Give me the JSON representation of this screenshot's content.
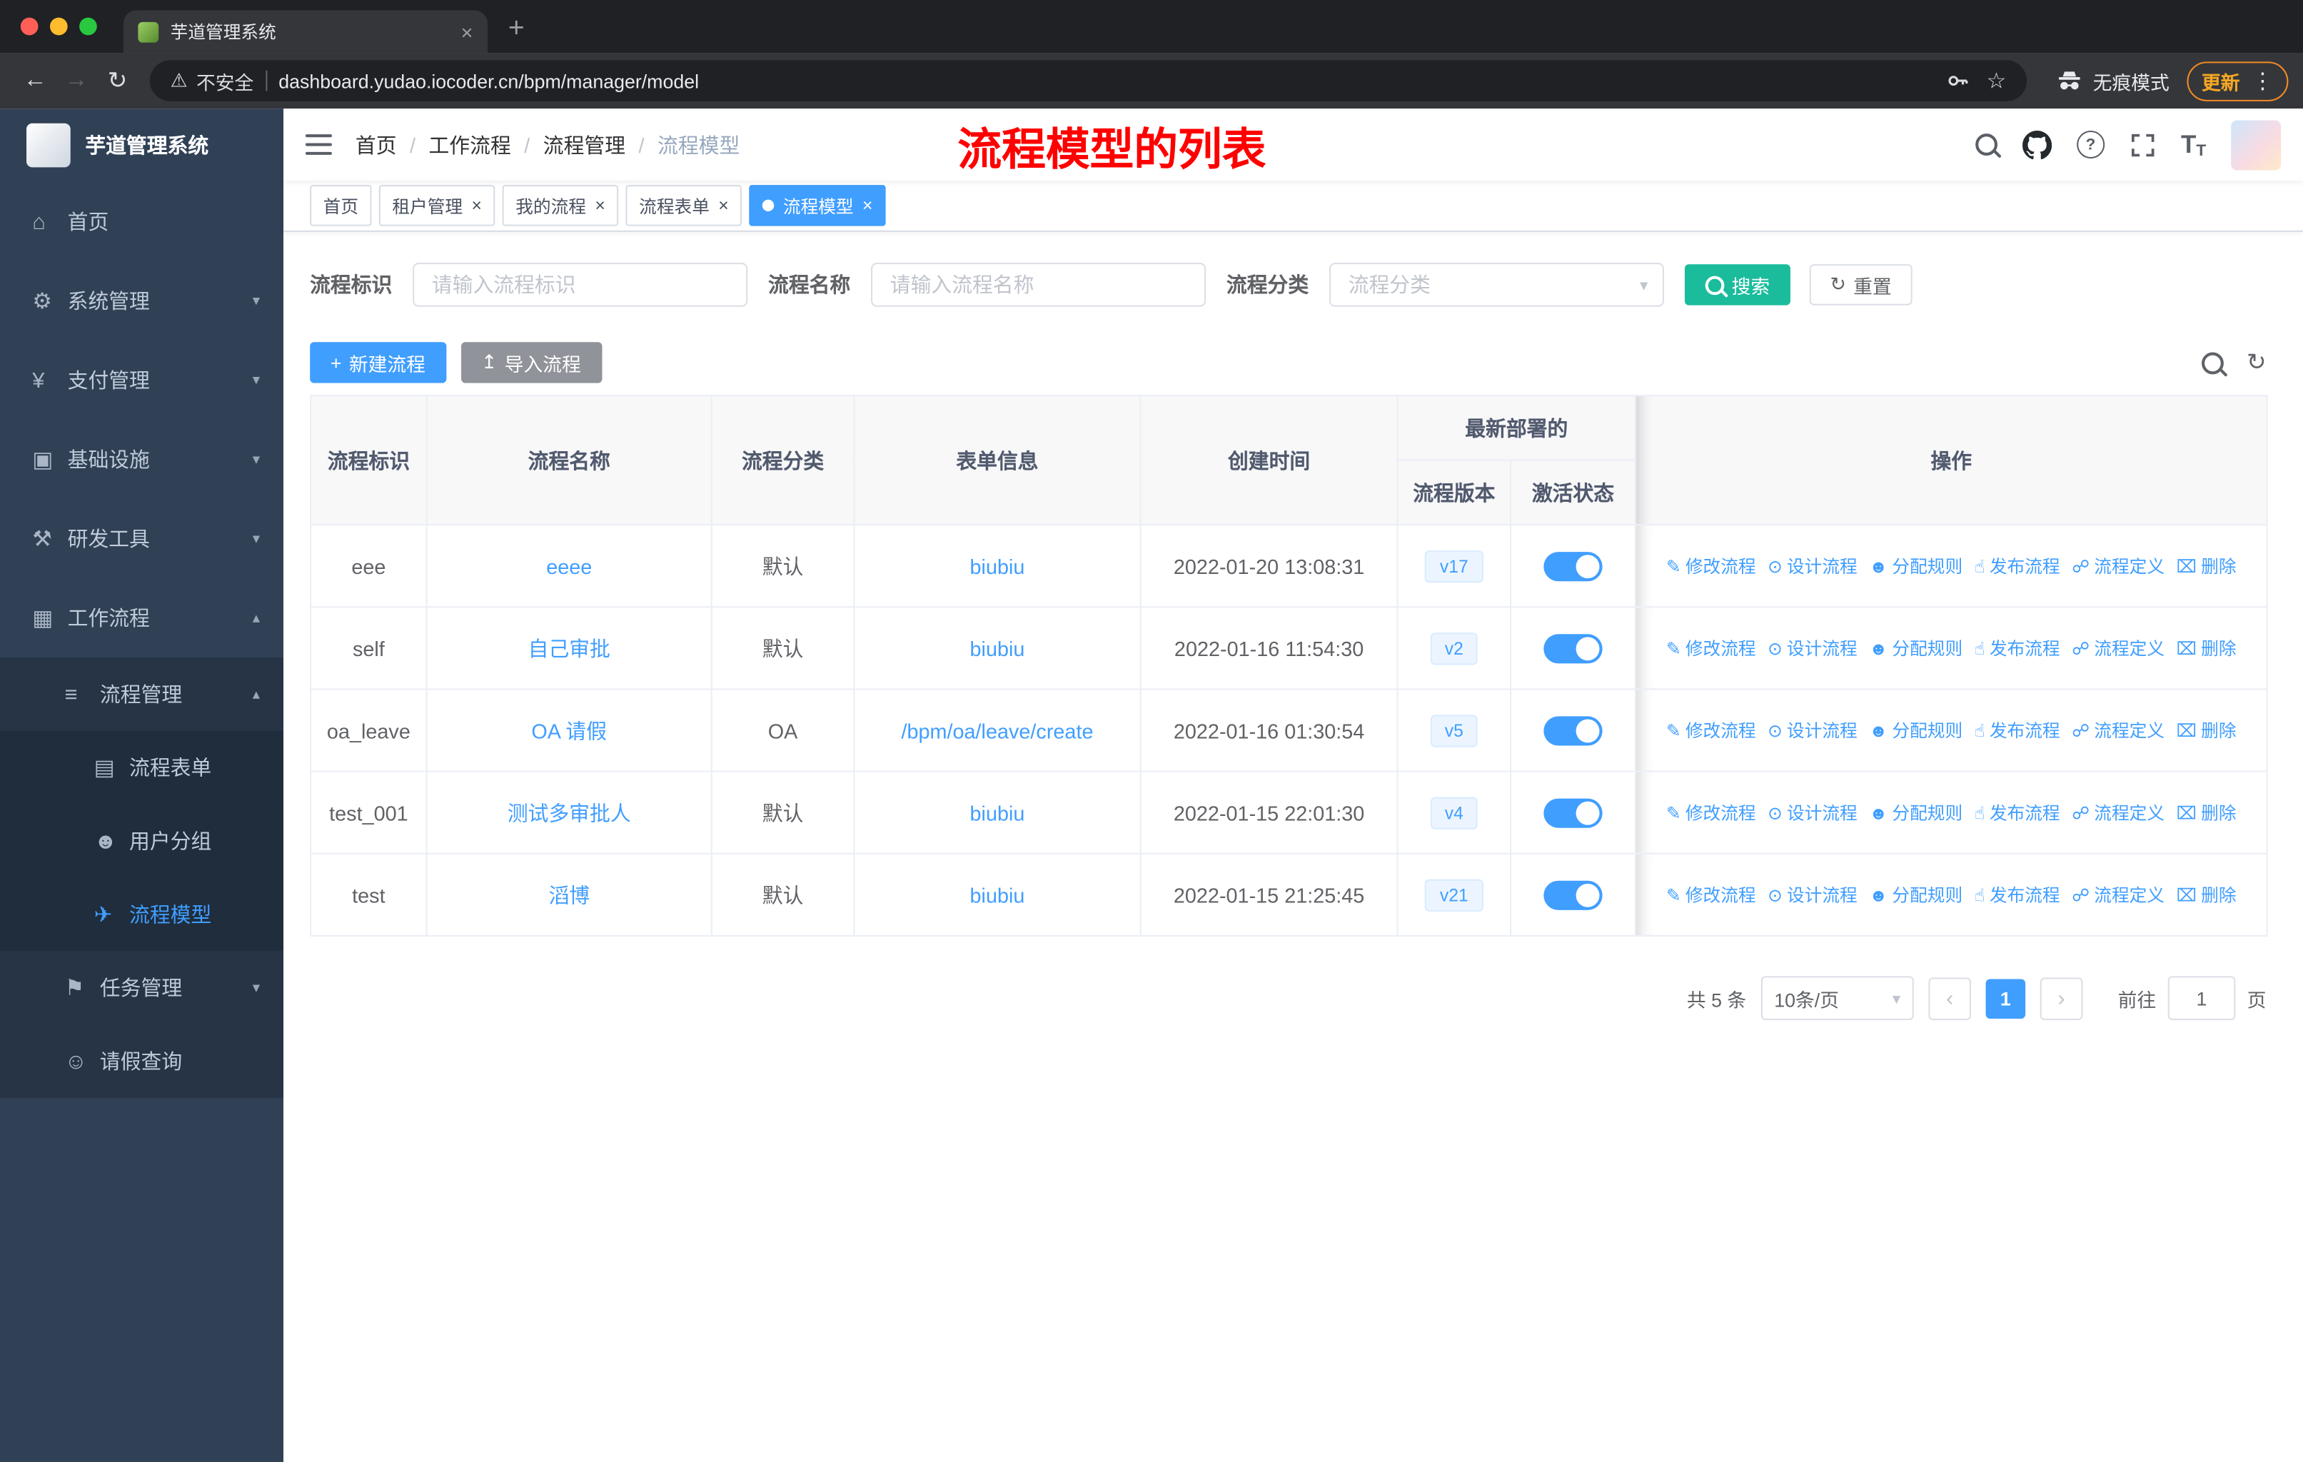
{
  "colors": {
    "primary": "#409EFF",
    "search_button": "#1ABC9C",
    "sidebar_bg": "#304156",
    "sidebar_sub_bg": "#263445",
    "sidebar_sub2_bg": "#1F2D3D",
    "annotation_red": "#FF0000",
    "update_chip": "#F28B25"
  },
  "browser": {
    "tab_title": "芋道管理系统",
    "security_text": "不安全",
    "url": "dashboard.yudao.iocoder.cn/bpm/manager/model",
    "incognito_label": "无痕模式",
    "update_label": "更新"
  },
  "header": {
    "breadcrumb": [
      "首页",
      "工作流程",
      "流程管理",
      "流程模型"
    ],
    "annotation": "流程模型的列表"
  },
  "tags": [
    {
      "key": "home",
      "label": "首页",
      "closable": false,
      "active": false
    },
    {
      "key": "tenant-manage",
      "label": "租户管理",
      "closable": true,
      "active": false
    },
    {
      "key": "my-process",
      "label": "我的流程",
      "closable": true,
      "active": false
    },
    {
      "key": "process-form",
      "label": "流程表单",
      "closable": true,
      "active": false
    },
    {
      "key": "process-model",
      "label": "流程模型",
      "closable": true,
      "active": true
    }
  ],
  "sidebar": {
    "logo_title": "芋道管理系统",
    "items": [
      {
        "key": "home",
        "label": "首页",
        "icon": "dashboard-icon",
        "level": 0,
        "chevron": null,
        "active": false
      },
      {
        "key": "system-manage",
        "label": "系统管理",
        "icon": "gear-icon",
        "level": 0,
        "chevron": "down",
        "active": false
      },
      {
        "key": "payment-manage",
        "label": "支付管理",
        "icon": "yen-icon",
        "level": 0,
        "chevron": "down",
        "active": false
      },
      {
        "key": "infrastructure",
        "label": "基础设施",
        "icon": "infrastructure-icon",
        "level": 0,
        "chevron": "down",
        "active": false
      },
      {
        "key": "dev-tools",
        "label": "研发工具",
        "icon": "tools-icon",
        "level": 0,
        "chevron": "down",
        "active": false
      },
      {
        "key": "workflow",
        "label": "工作流程",
        "icon": "workflow-icon",
        "level": 0,
        "chevron": "up",
        "active": false
      },
      {
        "key": "process-manage",
        "label": "流程管理",
        "icon": "process-manage-icon",
        "level": 1,
        "chevron": "up",
        "active": false
      },
      {
        "key": "process-form",
        "label": "流程表单",
        "icon": "form-icon",
        "level": 2,
        "chevron": null,
        "active": false
      },
      {
        "key": "user-group",
        "label": "用户分组",
        "icon": "user-group-icon",
        "level": 2,
        "chevron": null,
        "active": false
      },
      {
        "key": "process-model",
        "label": "流程模型",
        "icon": "paper-plane-icon",
        "level": 2,
        "chevron": null,
        "active": true
      },
      {
        "key": "task-manage",
        "label": "任务管理",
        "icon": "task-icon",
        "level": 1,
        "chevron": "down",
        "active": false
      },
      {
        "key": "leave-query",
        "label": "请假查询",
        "icon": "person-icon",
        "level": 1,
        "chevron": null,
        "active": false
      }
    ]
  },
  "filters": {
    "fields": [
      {
        "label": "流程标识",
        "placeholder": "请输入流程标识"
      },
      {
        "label": "流程名称",
        "placeholder": "请输入流程名称"
      },
      {
        "label": "流程分类",
        "placeholder": "流程分类"
      }
    ],
    "search_label": "搜索",
    "reset_label": "重置"
  },
  "toolbar": {
    "create_label": "新建流程",
    "import_label": "导入流程"
  },
  "table": {
    "columns": [
      "流程标识",
      "流程名称",
      "流程分类",
      "表单信息",
      "创建时间"
    ],
    "group_header": "最新部署的",
    "sub_columns": [
      "流程版本",
      "激活状态"
    ],
    "actions_header": "操作",
    "actions": [
      {
        "key": "modify-process",
        "label": "修改流程",
        "icon": "edit-icon"
      },
      {
        "key": "design-process",
        "label": "设计流程",
        "icon": "design-icon"
      },
      {
        "key": "assign-rule",
        "label": "分配规则",
        "icon": "assign-icon"
      },
      {
        "key": "publish-process",
        "label": "发布流程",
        "icon": "publish-icon"
      },
      {
        "key": "process-definition",
        "label": "流程定义",
        "icon": "definition-icon"
      },
      {
        "key": "delete",
        "label": "删除",
        "icon": "delete-icon"
      }
    ],
    "rows": [
      {
        "key": "eee",
        "name": "eeee",
        "category": "默认",
        "form": "biubiu",
        "created": "2022-01-20 13:08:31",
        "version": "v17",
        "active": true
      },
      {
        "key": "self",
        "name": "自己审批",
        "category": "默认",
        "form": "biubiu",
        "created": "2022-01-16 11:54:30",
        "version": "v2",
        "active": true
      },
      {
        "key": "oa_leave",
        "name": "OA 请假",
        "category": "OA",
        "form": "/bpm/oa/leave/create",
        "created": "2022-01-16 01:30:54",
        "version": "v5",
        "active": true
      },
      {
        "key": "test_001",
        "name": "测试多审批人",
        "category": "默认",
        "form": "biubiu",
        "created": "2022-01-15 22:01:30",
        "version": "v4",
        "active": true
      },
      {
        "key": "test",
        "name": "滔博",
        "category": "默认",
        "form": "biubiu",
        "created": "2022-01-15 21:25:45",
        "version": "v21",
        "active": true
      }
    ]
  },
  "pagination": {
    "total_text": "共 5 条",
    "page_size_label": "10条/页",
    "current_page": "1",
    "goto_label": "前往",
    "goto_value": "1",
    "page_unit": "页"
  },
  "icon_glyphs": {
    "dashboard-icon": "⌂",
    "gear-icon": "⚙",
    "yen-icon": "¥",
    "infrastructure-icon": "▣",
    "tools-icon": "⚒",
    "workflow-icon": "▦",
    "process-manage-icon": "≡",
    "form-icon": "▤",
    "user-group-icon": "☻",
    "paper-plane-icon": "✈",
    "task-icon": "⚑",
    "person-icon": "☺",
    "edit-icon": "✎",
    "design-icon": "⊙",
    "assign-icon": "☻",
    "publish-icon": "☝",
    "definition-icon": "☍",
    "delete-icon": "⌧",
    "refresh-icon": "↻",
    "upload-icon": "↥",
    "plus-icon": "+",
    "close-icon": "×",
    "star-icon": "☆",
    "warning-icon": "⚠",
    "back-icon": "←",
    "forward-icon": "→",
    "reload-icon": "↻",
    "more-icon": "⋮",
    "chevron-down-icon": "▾",
    "chevron-up-icon": "▴",
    "chevron-left-icon": "‹",
    "chevron-right-icon": "›",
    "help-icon": "?",
    "fontsize-icon": "T"
  }
}
